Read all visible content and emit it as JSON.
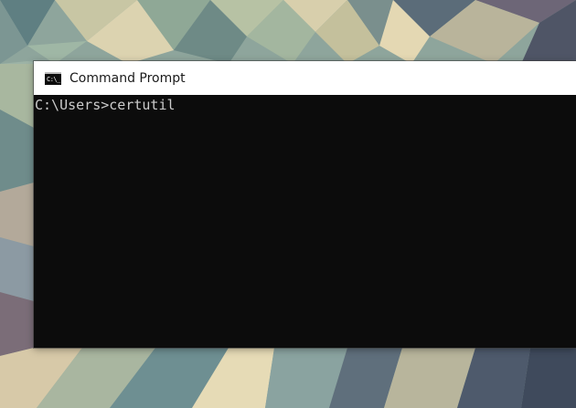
{
  "window": {
    "title": "Command Prompt",
    "icon": "command-prompt-icon",
    "icon_text": "C:\\_"
  },
  "console": {
    "lines": [
      "C:\\Users>certutil"
    ]
  },
  "colors": {
    "console_background": "#0c0c0c",
    "console_text": "#cccccc",
    "titlebar_background": "#ffffff"
  }
}
